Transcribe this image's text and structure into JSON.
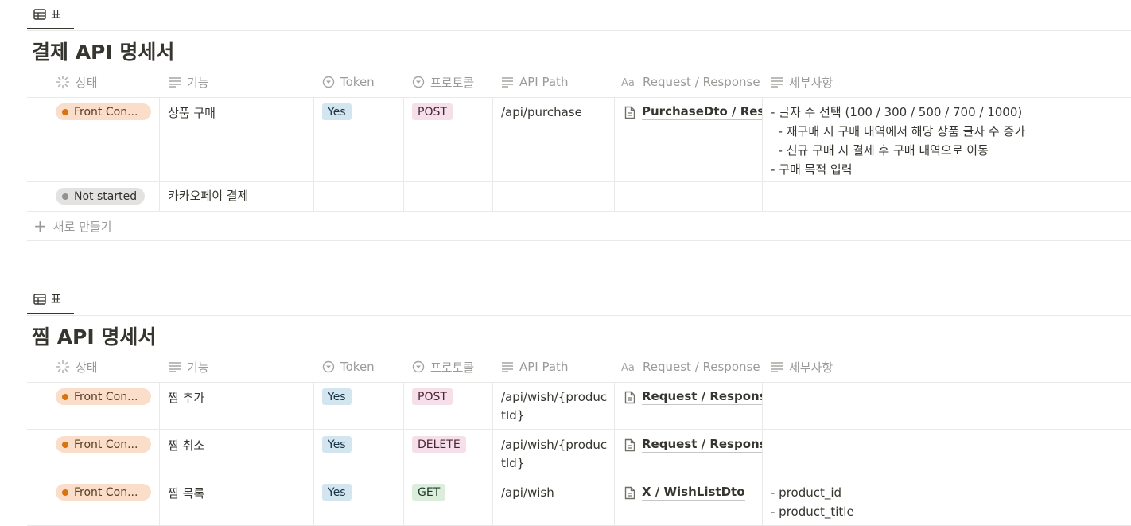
{
  "tab_label": "표",
  "columns": {
    "status": "상태",
    "feature": "기능",
    "token": "Token",
    "protocol": "프로토콜",
    "api_path": "API Path",
    "reqres": "Request / Response",
    "details": "세부사항"
  },
  "icons": {
    "tab": "table-icon",
    "status": "status-spinner-icon",
    "text": "text-lines-icon",
    "select": "select-circle-icon",
    "title": "aa-title-icon",
    "page": "page-icon",
    "plus": "plus-icon"
  },
  "colors": {
    "front_bg": "#fadec9",
    "front_dot": "#d9730d",
    "notstarted_bg": "#e3e2e0",
    "yes_bg": "#d3e5ef",
    "post_bg": "#f5e0e9",
    "get_bg": "#dbeddb"
  },
  "db1": {
    "title": "결제 API 명세서",
    "rows": [
      {
        "status": "Front Con...",
        "feature": "상품 구매",
        "token": "Yes",
        "protocol": "POST",
        "api_path": "/api/purchase",
        "reqres": "PurchaseDto / Response",
        "details": "- 글자 수 선택 (100 / 300 / 500 / 700 / 1000)\n  - 재구매 시 구매 내역에서 해당 상품 글자 수 증가\n  - 신규 구매 시 결제 후 구매 내역으로 이동\n- 구매 목적 입력"
      },
      {
        "status": "Not started",
        "feature": "카카오페이 결제"
      }
    ],
    "new_label": "새로 만들기"
  },
  "db2": {
    "title": "찜 API 명세서",
    "rows": [
      {
        "status": "Front Con...",
        "feature": "찜 추가",
        "token": "Yes",
        "protocol": "POST",
        "api_path": "/api/wish/{productId}",
        "reqres": "Request / Response",
        "details": ""
      },
      {
        "status": "Front Con...",
        "feature": "찜 취소",
        "token": "Yes",
        "protocol": "DELETE",
        "api_path": "/api/wish/{productId}",
        "reqres": "Request / Response",
        "details": ""
      },
      {
        "status": "Front Con...",
        "feature": "찜 목록",
        "token": "Yes",
        "protocol": "GET",
        "api_path": "/api/wish",
        "reqres": "X / WishListDto",
        "details": "- product_id\n- product_title"
      }
    ]
  }
}
